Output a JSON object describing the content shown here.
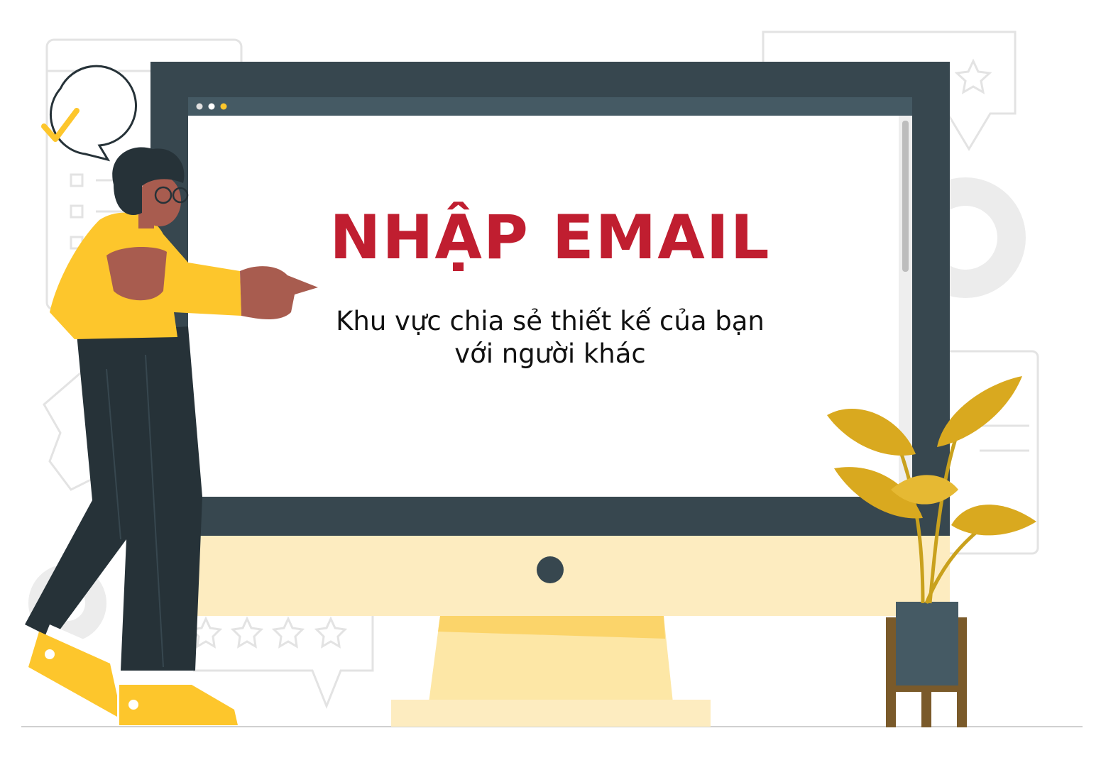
{
  "screen": {
    "title": "NHẬP EMAIL",
    "subtitle_line1": "Khu vực chia sẻ thiết kế của bạn",
    "subtitle_line2": "với người khác"
  },
  "colors": {
    "title": "#c01e30",
    "monitor_frame": "#37474f",
    "monitor_chin": "#fdecc0",
    "accent_yellow": "#fdc62c",
    "plant": "#d9a91f",
    "pot": "#455a64",
    "stand": "#7a5a2a"
  },
  "icons": [
    "checkmark-icon",
    "star-icon",
    "gear-icon",
    "window-dot-icon"
  ]
}
